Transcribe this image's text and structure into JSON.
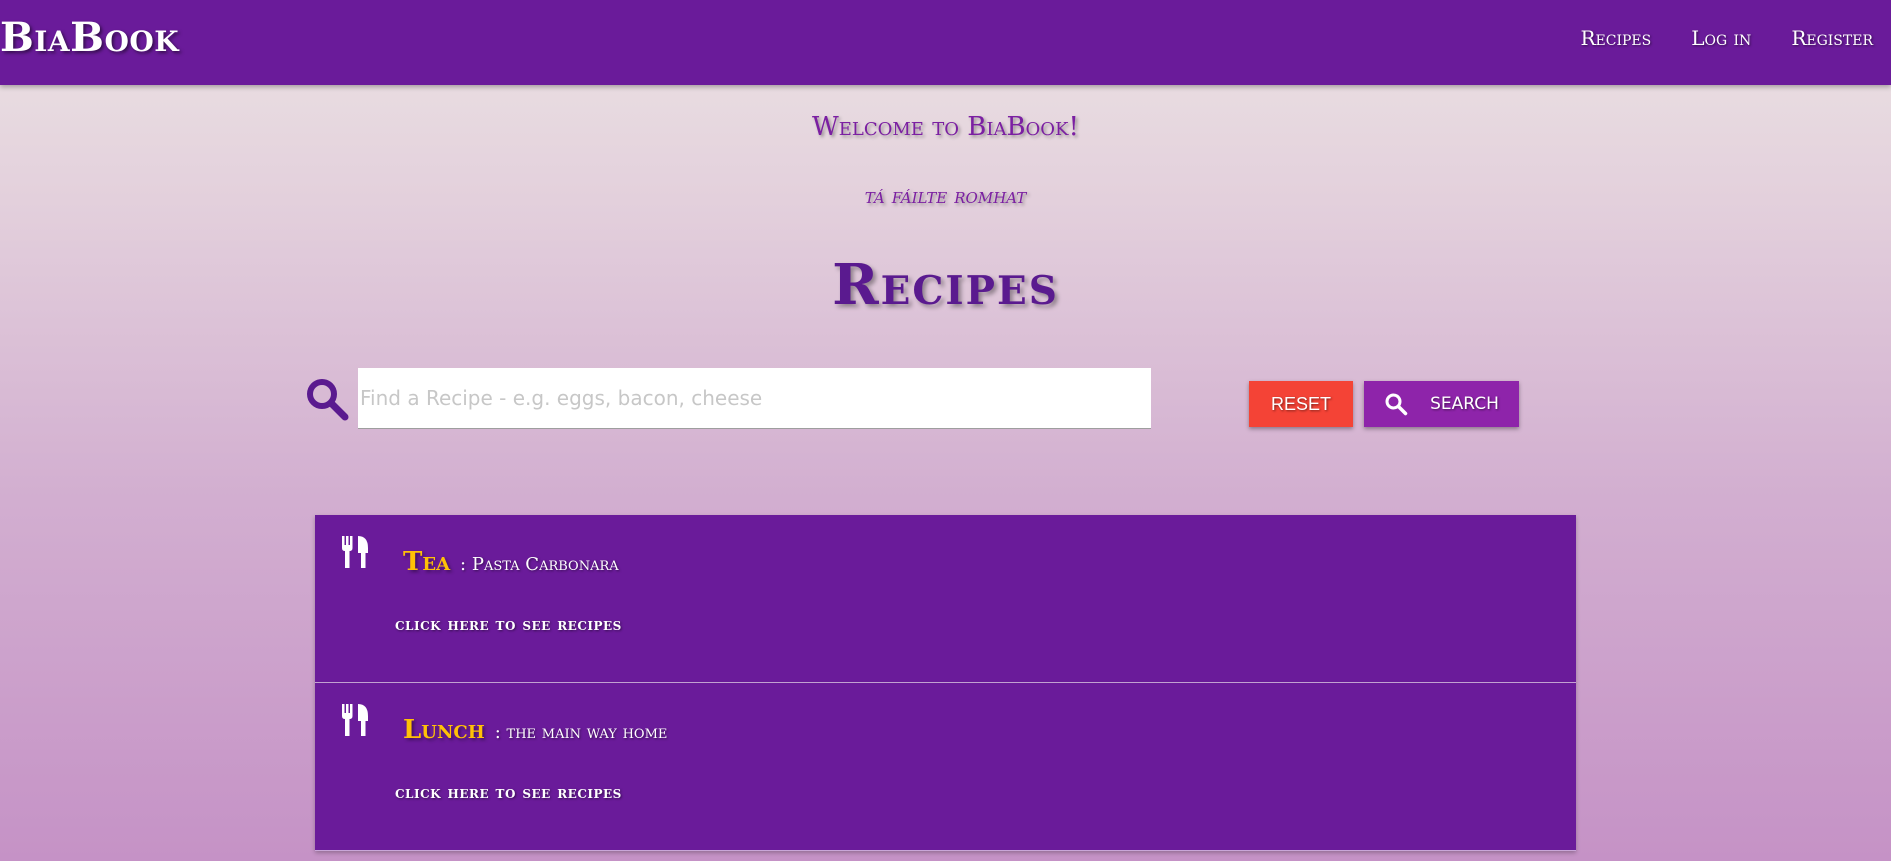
{
  "nav": {
    "brand": "BiaBook",
    "links": [
      "Recipes",
      "Log in",
      "Register"
    ]
  },
  "header": {
    "welcome": "Welcome to BiaBook!",
    "subtitle": "tá fáilte romhat",
    "title": "Recipes"
  },
  "search": {
    "icon": "search-icon",
    "placeholder": "Find a Recipe - e.g. eggs, bacon, cheese",
    "value": "",
    "reset_label": "RESET",
    "search_label": "SEARCH"
  },
  "recipes": [
    {
      "icon": "utensils-icon",
      "category": "Tea",
      "name": ": Pasta Carbonara",
      "link": "click here to see recipes"
    },
    {
      "icon": "utensils-icon",
      "category": "Lunch",
      "name": ": the main way home",
      "link": "click here to see recipes"
    }
  ],
  "colors": {
    "primary": "#6a1b9a",
    "accent": "#ffc107",
    "reset": "#f44336",
    "search_button": "#8e24aa"
  }
}
